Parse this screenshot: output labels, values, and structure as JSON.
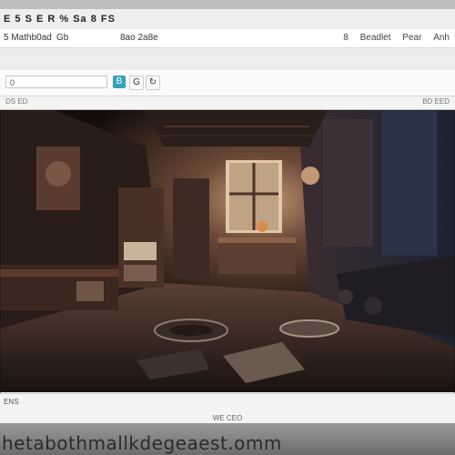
{
  "window": {
    "title": "E 5 S  E  R  % Sa 8 FS"
  },
  "menu": {
    "items": [
      "5 Mathb0ad",
      "Gb",
      "8ao 2a8e"
    ],
    "right_items": [
      "8",
      "Beadlet",
      "Pear",
      "Anh"
    ]
  },
  "toolbar": {
    "address_text": "0",
    "buttons": [
      "B",
      "G"
    ]
  },
  "status": {
    "left": "DS ED",
    "right": "BD EED"
  },
  "bottom": {
    "left": "ENS",
    "center": "WE CEO"
  },
  "bezel": {
    "url": "hetabothmallkdegeaest.omm"
  },
  "colors": {
    "accent": "#3aa0b8",
    "scene_warm": "#d98c4a",
    "scene_cool": "#4a6b8c"
  }
}
